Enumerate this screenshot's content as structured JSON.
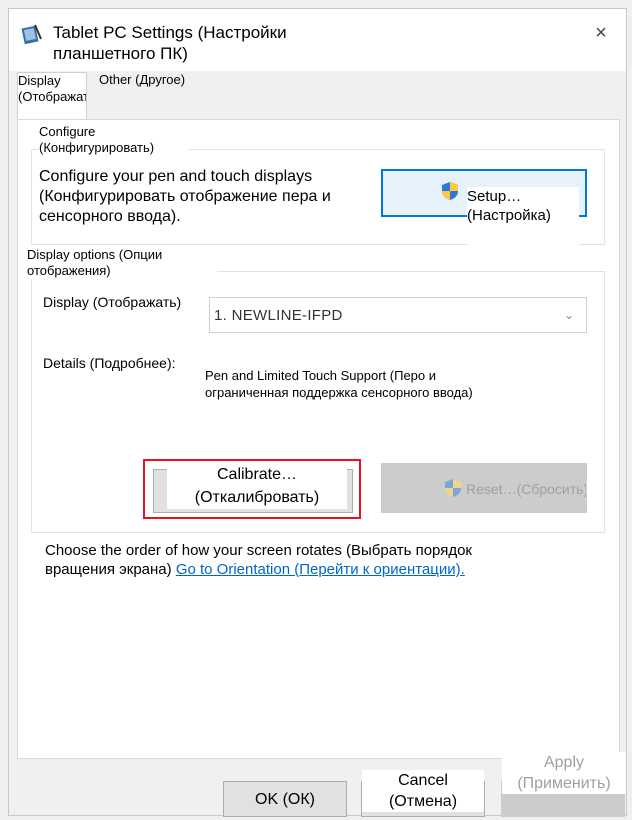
{
  "window": {
    "title": "Tablet PC Settings (Настройки планшетного ПК)",
    "close_glyph": "×",
    "icon": "tablet-pc-icon"
  },
  "tabs": [
    {
      "label": "Display (Отображать)"
    },
    {
      "label": "Other (Другое)"
    }
  ],
  "configure": {
    "group_label": "Configure (Конфигурировать)",
    "description": "Configure your pen and touch displays (Конфигурировать отображение пера и сенсорного ввода).",
    "setup_button": "Setup…(Настройка)",
    "shield_icon": "uac-shield-icon"
  },
  "display_options": {
    "group_label": "Display options (Опции отображения)",
    "display_label": "Display (Отображать)",
    "display_value": "1. NEWLINE-IFPD",
    "details_label": "Details (Подробнее):",
    "details_value": "Pen and Limited Touch Support (Перо и ограниченная поддержка сенсорного ввода)",
    "calibrate_button": "Calibrate…(Откалибровать)",
    "reset_button": "Reset…(Сбросить)"
  },
  "orientation": {
    "text": "Choose the order of how your screen rotates (Выбрать порядок вращения экрана) ",
    "link": "Go to Orientation (Перейти к ориентации)."
  },
  "footer": {
    "ok": "OK (ОК)",
    "cancel": "Cancel (Отмена)",
    "apply": "Apply (Применить)"
  },
  "colors": {
    "accent_blue": "#0078d7",
    "focus_red": "#e81123",
    "link": "#0066cc"
  }
}
